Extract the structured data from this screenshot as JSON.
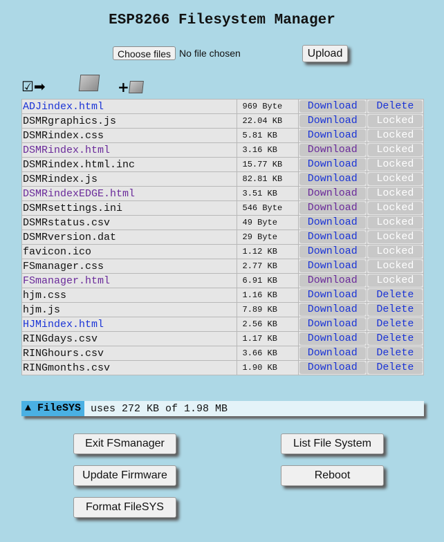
{
  "title": "ESP8266 Filesystem Manager",
  "upload_form": {
    "choose_label": "Choose files",
    "no_file_text": "No file chosen",
    "upload_label": "Upload"
  },
  "toolbar": {
    "select_icon": "☑➡",
    "folder_icon": "folder-icon",
    "new_folder_icon": "new-folder-icon",
    "plus": "+"
  },
  "files": [
    {
      "name": "ADJindex.html",
      "size": "969 Byte",
      "download": "Download",
      "action": "Delete",
      "name_style": "link",
      "dl_style": "link"
    },
    {
      "name": "DSMRgraphics.js",
      "size": "22.04 KB",
      "download": "Download",
      "action": "Locked",
      "name_style": "plain",
      "dl_style": "link"
    },
    {
      "name": "DSMRindex.css",
      "size": "5.81 KB",
      "download": "Download",
      "action": "Locked",
      "name_style": "plain",
      "dl_style": "link"
    },
    {
      "name": "DSMRindex.html",
      "size": "3.16 KB",
      "download": "Download",
      "action": "Locked",
      "name_style": "visited",
      "dl_style": "visited"
    },
    {
      "name": "DSMRindex.html.inc",
      "size": "15.77 KB",
      "download": "Download",
      "action": "Locked",
      "name_style": "plain",
      "dl_style": "link"
    },
    {
      "name": "DSMRindex.js",
      "size": "82.81 KB",
      "download": "Download",
      "action": "Locked",
      "name_style": "plain",
      "dl_style": "link"
    },
    {
      "name": "DSMRindexEDGE.html",
      "size": "3.51 KB",
      "download": "Download",
      "action": "Locked",
      "name_style": "visited",
      "dl_style": "visited"
    },
    {
      "name": "DSMRsettings.ini",
      "size": "546 Byte",
      "download": "Download",
      "action": "Locked",
      "name_style": "plain",
      "dl_style": "visited"
    },
    {
      "name": "DSMRstatus.csv",
      "size": "49 Byte",
      "download": "Download",
      "action": "Locked",
      "name_style": "plain",
      "dl_style": "link"
    },
    {
      "name": "DSMRversion.dat",
      "size": "29 Byte",
      "download": "Download",
      "action": "Locked",
      "name_style": "plain",
      "dl_style": "link"
    },
    {
      "name": "favicon.ico",
      "size": "1.12 KB",
      "download": "Download",
      "action": "Locked",
      "name_style": "plain",
      "dl_style": "link"
    },
    {
      "name": "FSmanager.css",
      "size": "2.77 KB",
      "download": "Download",
      "action": "Locked",
      "name_style": "plain",
      "dl_style": "link"
    },
    {
      "name": "FSmanager.html",
      "size": "6.91 KB",
      "download": "Download",
      "action": "Locked",
      "name_style": "visited",
      "dl_style": "visited"
    },
    {
      "name": "hjm.css",
      "size": "1.16 KB",
      "download": "Download",
      "action": "Delete",
      "name_style": "plain",
      "dl_style": "link"
    },
    {
      "name": "hjm.js",
      "size": "7.89 KB",
      "download": "Download",
      "action": "Delete",
      "name_style": "plain",
      "dl_style": "link"
    },
    {
      "name": "HJMindex.html",
      "size": "2.56 KB",
      "download": "Download",
      "action": "Delete",
      "name_style": "link",
      "dl_style": "link"
    },
    {
      "name": "RINGdays.csv",
      "size": "1.17 KB",
      "download": "Download",
      "action": "Delete",
      "name_style": "plain",
      "dl_style": "link"
    },
    {
      "name": "RINGhours.csv",
      "size": "3.66 KB",
      "download": "Download",
      "action": "Delete",
      "name_style": "plain",
      "dl_style": "link"
    },
    {
      "name": "RINGmonths.csv",
      "size": "1.90 KB",
      "download": "Download",
      "action": "Delete",
      "name_style": "plain",
      "dl_style": "link"
    }
  ],
  "filesys": {
    "label": "▲ FileSYS",
    "usage": "uses 272 KB of 1.98 MB"
  },
  "buttons": {
    "exit": "Exit FSmanager",
    "list": "List File System",
    "update": "Update Firmware",
    "reboot": "Reboot",
    "format": "Format FileSYS"
  },
  "colors": {
    "background": "#add8e6",
    "link": "#1a33d6",
    "visited": "#6a2a9a",
    "filesys_label_bg": "#4ab0e3"
  }
}
